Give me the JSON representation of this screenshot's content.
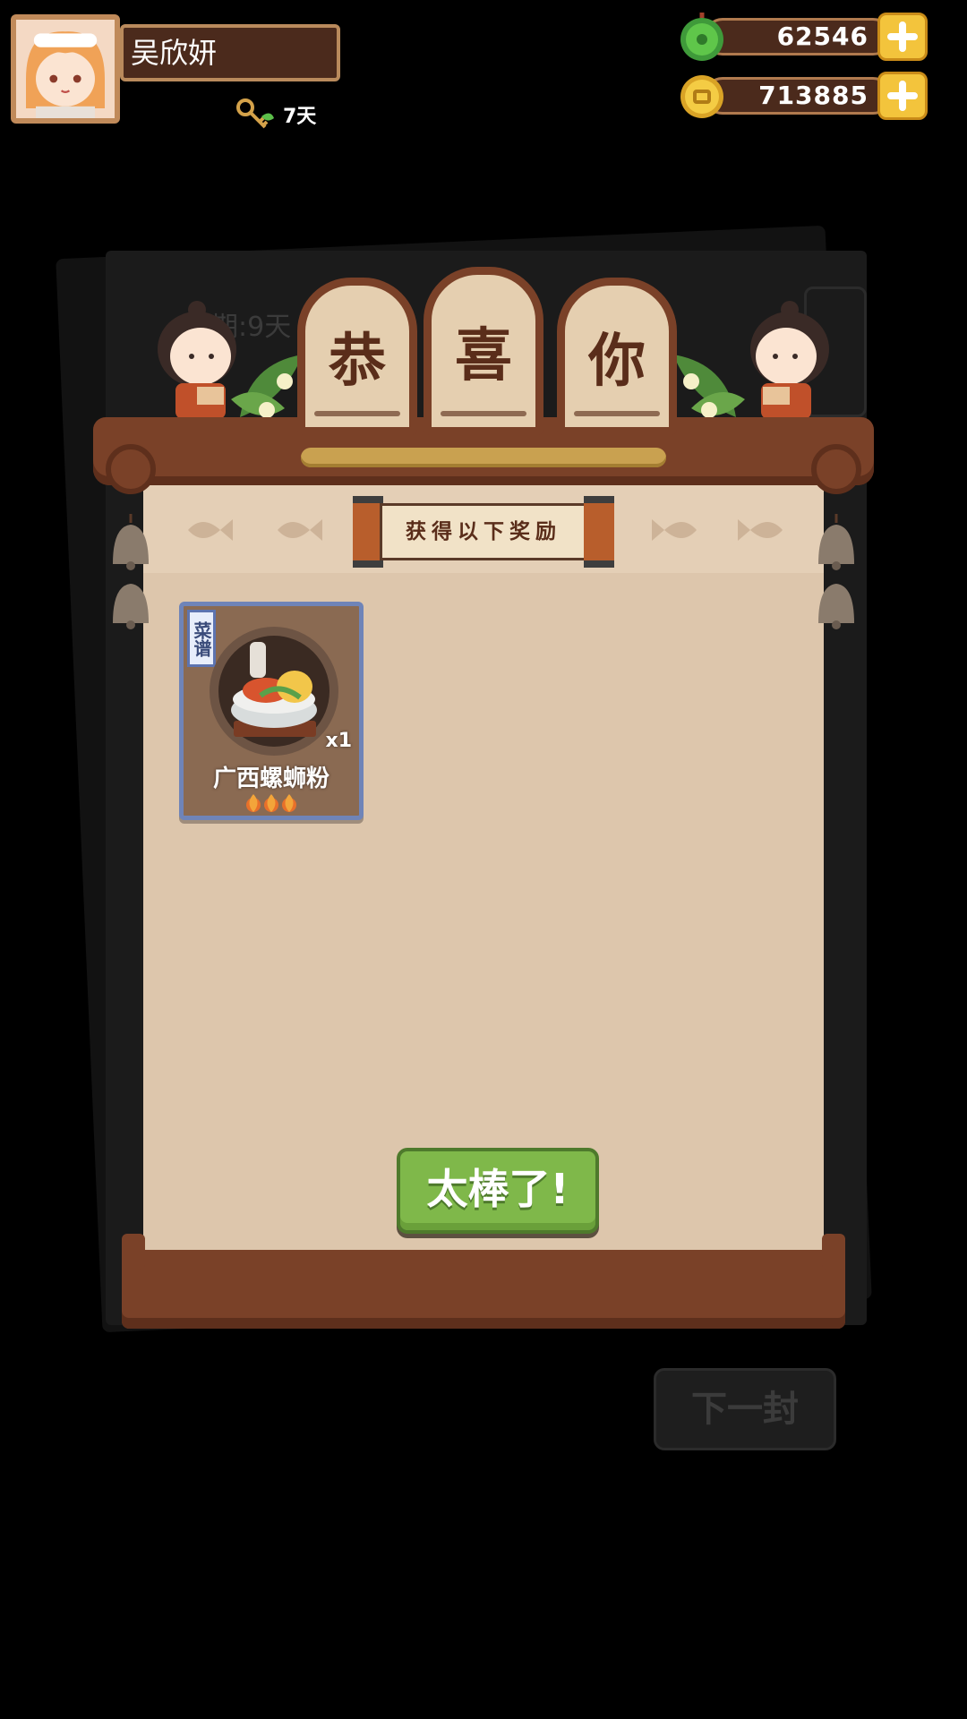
{
  "player": {
    "name": "吴欣妍",
    "days": "7天"
  },
  "currencies": [
    {
      "name": "jade",
      "value": "62546"
    },
    {
      "name": "coin",
      "value": "713885"
    }
  ],
  "background_ui": {
    "timer_text": "期:9天",
    "next_button": "下一封"
  },
  "dialog": {
    "title_chars": [
      "恭",
      "喜",
      "你"
    ],
    "subtitle": "获得以下奖励",
    "reward": {
      "tag": "菜谱",
      "name": "广西螺蛳粉",
      "quantity": "x1",
      "flames": 3
    },
    "confirm_button": "太棒了!"
  },
  "colors": {
    "wood": "#7a4128",
    "paper": "#ddc6ac",
    "confirm_green": "#7fb84a",
    "plus_gold": "#f3c43c",
    "card_border": "#6f84b8"
  }
}
